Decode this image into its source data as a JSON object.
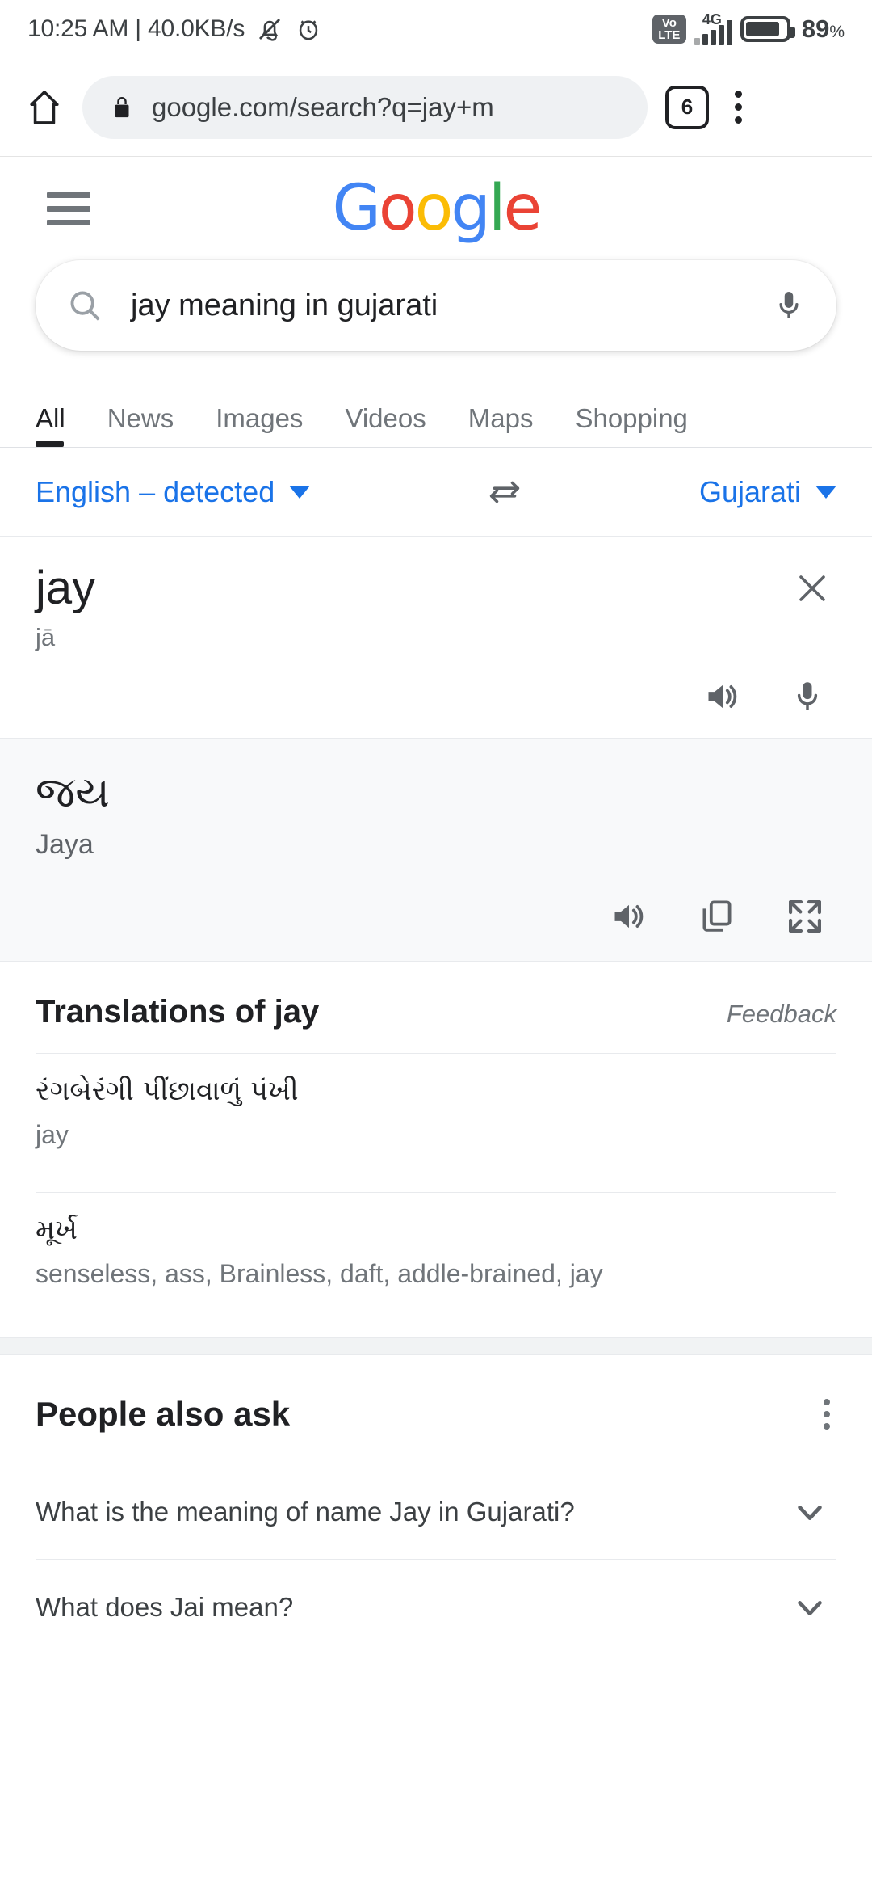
{
  "status_bar": {
    "clock": "10:25 AM | 40.0KB/s",
    "mute_icon": "bell-muted-icon",
    "alarm_icon": "alarm-clock-icon",
    "volte_top": "Vo",
    "volte_bottom": "LTE",
    "network_type": "4G",
    "signal_icon": "signal-bars-icon",
    "battery_icon": "battery-icon",
    "battery_percent": "89",
    "battery_percent_symbol": "%"
  },
  "browser": {
    "home_icon": "home-icon",
    "lock_icon": "lock-icon",
    "url": "google.com/search?q=jay+m",
    "tab_count": "6",
    "menu_icon": "kebab-menu-icon"
  },
  "google_header": {
    "menu_icon": "hamburger-menu-icon",
    "logo": {
      "g1": "G",
      "o1": "o",
      "o2": "o",
      "g2": "g",
      "l": "l",
      "e": "e"
    }
  },
  "search": {
    "search_icon": "search-icon",
    "query": "jay meaning in gujarati",
    "mic_icon": "microphone-icon"
  },
  "tabs": [
    {
      "label": "All",
      "active": true
    },
    {
      "label": "News",
      "active": false
    },
    {
      "label": "Images",
      "active": false
    },
    {
      "label": "Videos",
      "active": false
    },
    {
      "label": "Maps",
      "active": false
    },
    {
      "label": "Shopping",
      "active": false
    }
  ],
  "language_bar": {
    "source_language": "English – detected",
    "swap_icon": "swap-arrows-icon",
    "target_language": "Gujarati",
    "link_color": "#1a73e8"
  },
  "source_panel": {
    "word": "jay",
    "transliteration": "jā",
    "close_icon": "close-icon",
    "speaker_icon": "speaker-icon",
    "mic_icon": "microphone-icon"
  },
  "translation_panel": {
    "word": "જય",
    "transliteration": "Jaya",
    "background": "#f8f9fa",
    "speaker_icon": "speaker-icon",
    "copy_icon": "copy-icon",
    "expand_icon": "fullscreen-expand-icon"
  },
  "translations_section": {
    "title": "Translations of jay",
    "feedback_label": "Feedback",
    "items": [
      {
        "gujarati": "રંગબેરંગી પીંછાવાળું પંખી",
        "english": "jay"
      },
      {
        "gujarati": "મૂર્ખ",
        "english": "senseless, ass, Brainless, daft, addle-brained, jay"
      }
    ]
  },
  "people_also_ask": {
    "title": "People also ask",
    "menu_icon": "kebab-menu-icon",
    "questions": [
      {
        "text": "What is the meaning of name Jay in Gujarati?",
        "chevron_icon": "chevron-down-icon"
      },
      {
        "text": "What does Jai mean?",
        "chevron_icon": "chevron-down-icon"
      }
    ]
  }
}
